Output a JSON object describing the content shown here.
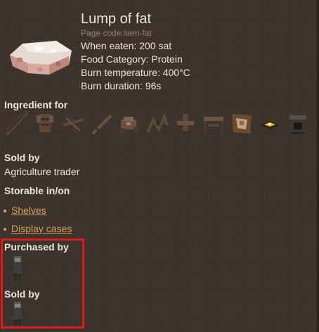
{
  "item": {
    "title": "Lump of fat",
    "page_code": "Page code:item-fat",
    "stats": [
      "When eaten: 200 sat",
      "Food Category: Protein",
      "Burn temperature: 400°C",
      "Burn duration: 96s"
    ],
    "icon": "lump-of-fat-icon"
  },
  "sections": {
    "ingredient_for": "Ingredient for",
    "sold_by": "Sold by",
    "sold_by_value": "Agriculture trader",
    "storable": "Storable in/on",
    "purchased_by": "Purchased by",
    "sold_by_2": "Sold by"
  },
  "storable_items": [
    {
      "label": "Shelves"
    },
    {
      "label": "Display cases"
    }
  ],
  "ingredient_icons": [
    "bow-icon",
    "leather-armor-icon",
    "crossbow-icon",
    "sword-icon",
    "saddle-icon",
    "harness-icon",
    "armor-stand-icon",
    "bench-icon",
    "trophy-icon",
    "lamp-icon",
    "furnace-icon"
  ],
  "colors": {
    "background": "#3c332c",
    "link": "#d4a15a",
    "highlight": "#e01b1b"
  }
}
